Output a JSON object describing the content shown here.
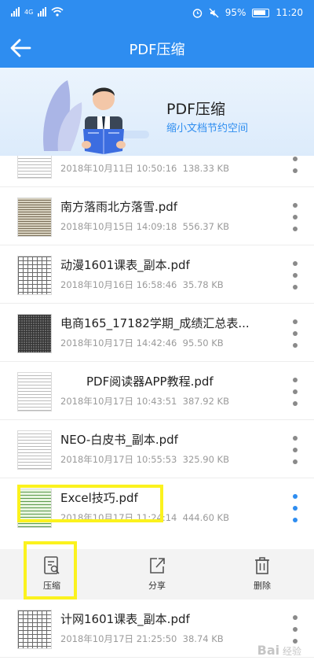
{
  "status_bar": {
    "signal1": "ᴴᴰ",
    "signal2": "4G",
    "battery_pct": "95%",
    "time": "11:20"
  },
  "app_bar": {
    "title": "PDF压缩"
  },
  "banner": {
    "title": "PDF压缩",
    "subtitle": "缩小文档节约空间"
  },
  "files": [
    {
      "name": "",
      "date": "2018年10月11日 10:50:16",
      "size": "138.33 KB",
      "thumb": "text"
    },
    {
      "name": "南方落雨北方落雪.pdf",
      "date": "2018年10月15日 14:09:18",
      "size": "556.37 KB",
      "thumb": "old"
    },
    {
      "name": "动漫1601课表_副本.pdf",
      "date": "2018年10月16日 16:58:46",
      "size": "35.78 KB",
      "thumb": "grid"
    },
    {
      "name": "电商165_17182学期_成绩汇总表...",
      "date": "2018年10月17日 14:42:46",
      "size": "95.50 KB",
      "thumb": "dense"
    },
    {
      "name": "PDF阅读器APP教程.pdf",
      "date": "2018年10月17日 10:43:51",
      "size": "387.92 KB",
      "thumb": "text"
    },
    {
      "name": "NEO-白皮书_副本.pdf",
      "date": "2018年10月17日 10:55:53",
      "size": "325.90 KB",
      "thumb": "text"
    },
    {
      "name": "Excel技巧.pdf",
      "date": "2018年10月17日 11:24:14",
      "size": "444.60 KB",
      "thumb": "text"
    },
    {
      "name": "计网1601课表_副本.pdf",
      "date": "2018年10月17日 21:25:50",
      "size": "38.74 KB",
      "thumb": "grid"
    }
  ],
  "actions": {
    "compress": "压缩",
    "share": "分享",
    "delete": "删除"
  },
  "watermark": {
    "logo": "Bai",
    "text": "经验"
  },
  "colors": {
    "primary": "#2e8df0",
    "highlight": "#fbf21e"
  }
}
